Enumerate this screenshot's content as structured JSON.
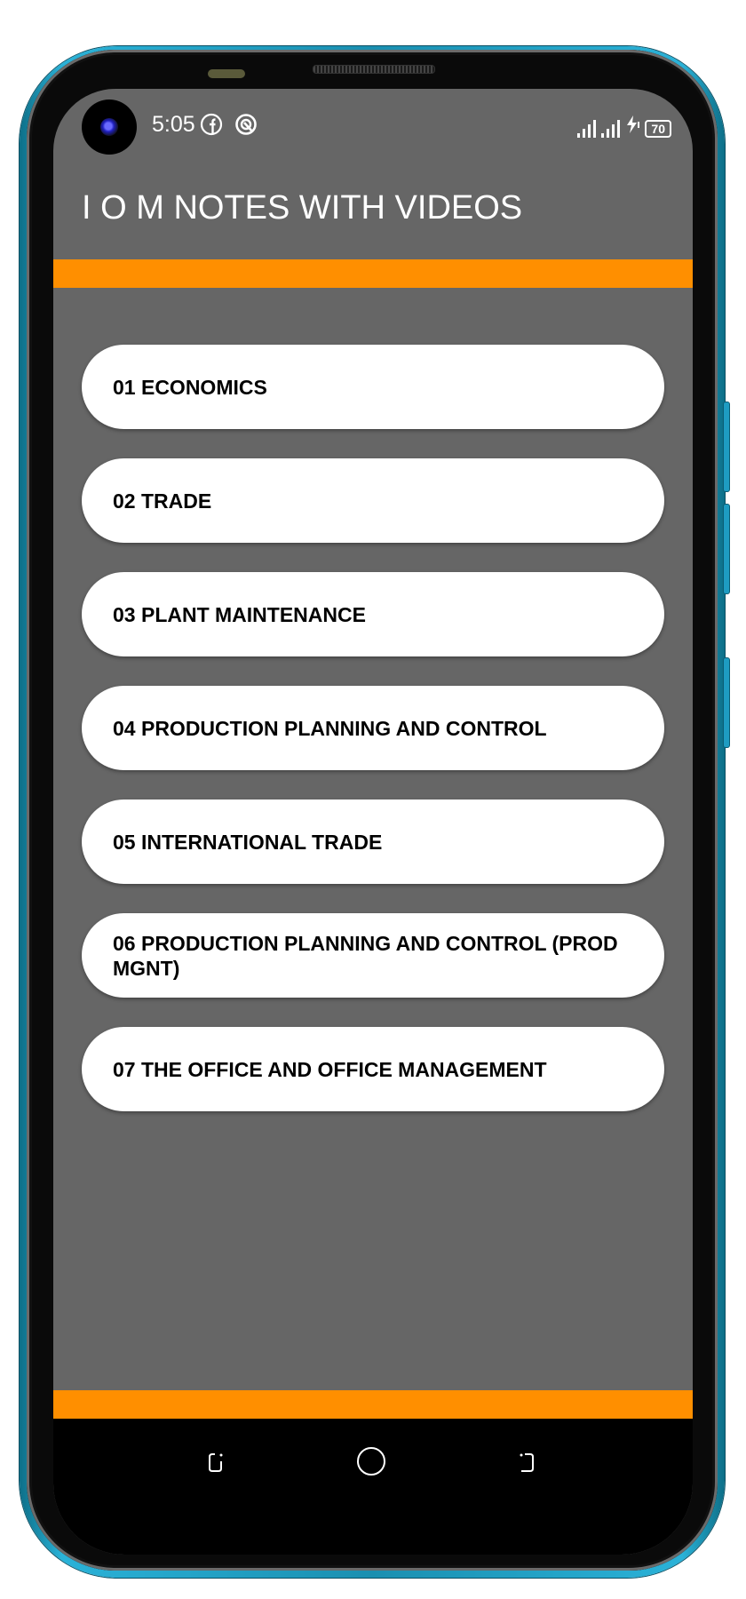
{
  "status_bar": {
    "time": "5:05",
    "notification_icons": [
      "facebook-icon",
      "sync-circle-icon"
    ],
    "signal_icons": [
      "signal-sim1-icon",
      "signal-sim2-icon"
    ],
    "charging_icon": "bolt-icon",
    "battery_level": "70"
  },
  "app_bar": {
    "title": "I O M NOTES WITH VIDEOS"
  },
  "colors": {
    "accent": "#ff8f00",
    "background": "#666666",
    "card": "#ffffff",
    "navbar": "#000000"
  },
  "menu": {
    "items": [
      {
        "label": "01 ECONOMICS"
      },
      {
        "label": "02 TRADE"
      },
      {
        "label": "03 PLANT MAINTENANCE"
      },
      {
        "label": "04 PRODUCTION PLANNING AND CONTROL"
      },
      {
        "label": "05 INTERNATIONAL TRADE"
      },
      {
        "label": "06 PRODUCTION PLANNING AND CONTROL (PROD MGNT)"
      },
      {
        "label": "07 THE OFFICE AND OFFICE MANAGEMENT"
      }
    ]
  },
  "nav_bar": {
    "buttons": [
      "recents-icon",
      "home-icon",
      "back-icon"
    ]
  }
}
